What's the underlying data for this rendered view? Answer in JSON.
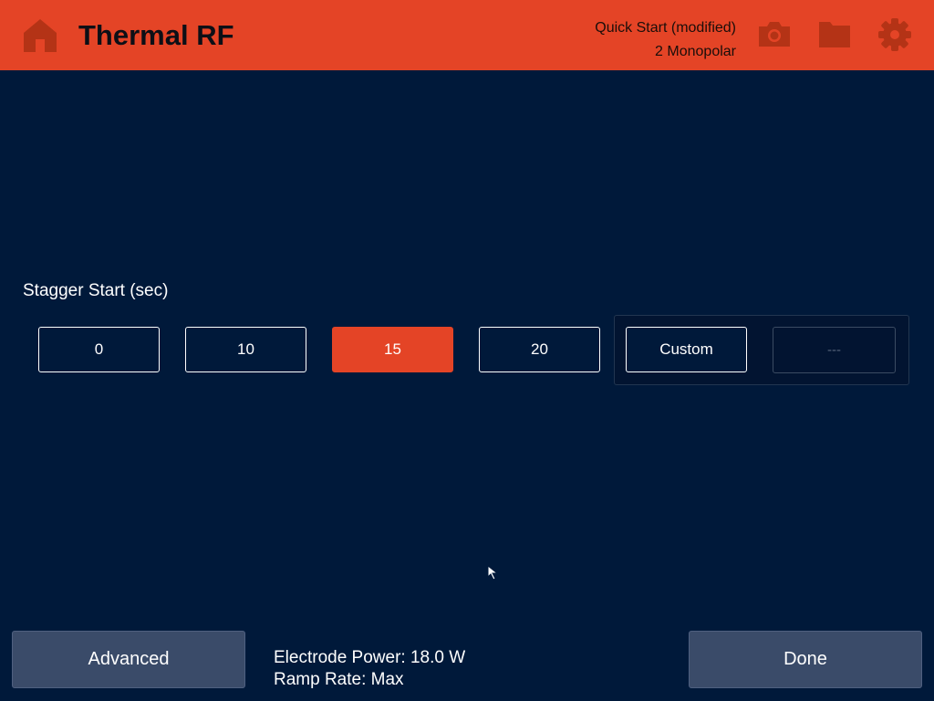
{
  "header": {
    "title": "Thermal RF",
    "preset_name": "Quick Start (modified)",
    "preset_mode": "2 Monopolar",
    "icons": {
      "home": "home-icon",
      "camera": "camera-icon",
      "folder": "folder-icon",
      "settings": "gear-icon"
    }
  },
  "stagger_start": {
    "label": "Stagger Start (sec)",
    "options": [
      "0",
      "10",
      "15",
      "20"
    ],
    "selected": "15",
    "custom_label": "Custom",
    "custom_value": "---"
  },
  "footer": {
    "advanced_label": "Advanced",
    "done_label": "Done",
    "electrode_power": "Electrode Power: 18.0 W",
    "ramp_rate": "Ramp Rate: Max"
  },
  "colors": {
    "accent": "#e44426",
    "background": "#00193a",
    "footer_button": "#3a4b69"
  }
}
